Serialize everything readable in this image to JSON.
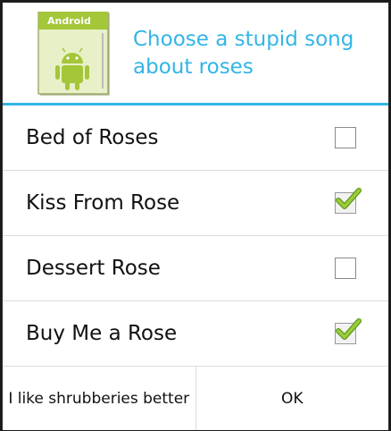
{
  "dialog": {
    "title": "Choose a stupid song about roses",
    "icon": {
      "name": "android-icon",
      "badge_text": "Android",
      "accent": "#a4c639"
    }
  },
  "items": [
    {
      "label": "Bed of Roses",
      "checked": false
    },
    {
      "label": "Kiss From Rose",
      "checked": true
    },
    {
      "label": "Dessert Rose",
      "checked": false
    },
    {
      "label": "Buy Me a Rose",
      "checked": true
    }
  ],
  "buttons": {
    "negative_label": "I like shrubberies better",
    "positive_label": "OK"
  },
  "colors": {
    "title": "#33b5e5",
    "divider": "#33b5e5",
    "check": "#8bc34a"
  }
}
